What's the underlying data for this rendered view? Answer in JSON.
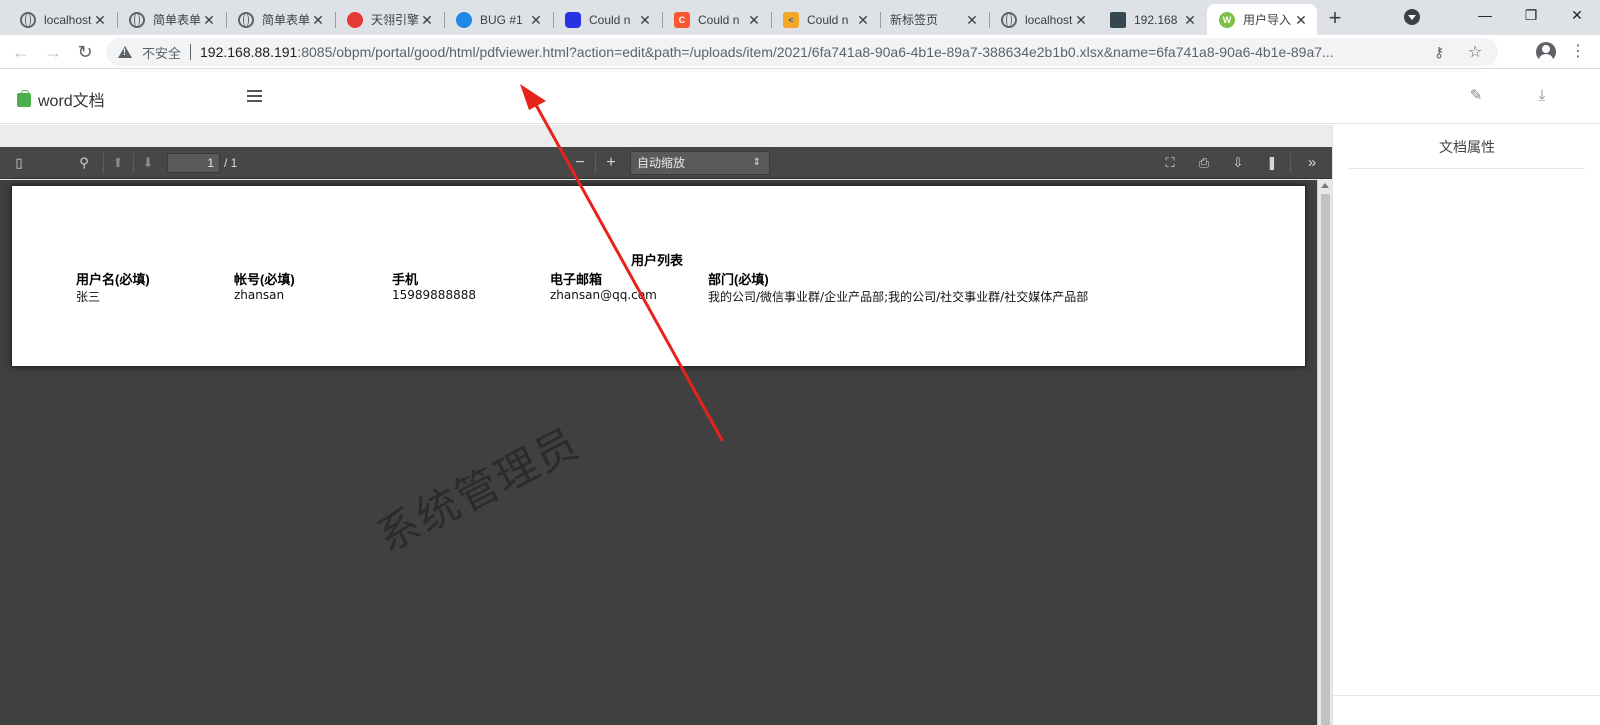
{
  "browser": {
    "tabs": [
      {
        "title": "localhost",
        "icon": "globe-icon",
        "active": false
      },
      {
        "title": "简单表单",
        "icon": "globe-icon",
        "active": false
      },
      {
        "title": "简单表单",
        "icon": "globe-icon",
        "active": false
      },
      {
        "title": "天翎引擎",
        "icon": "tianling-icon",
        "active": false
      },
      {
        "title": "BUG #1",
        "icon": "bug-tracker-icon",
        "active": false
      },
      {
        "title": "Could n",
        "icon": "baidu-paw-icon",
        "active": false
      },
      {
        "title": "Could n",
        "icon": "csdn-c-icon",
        "active": false
      },
      {
        "title": "Could n",
        "icon": "k-bracket-icon",
        "active": false
      },
      {
        "title": "新标签页",
        "icon": "",
        "active": false
      },
      {
        "title": "localhost",
        "icon": "globe-icon",
        "active": false
      },
      {
        "title": "192.168",
        "icon": "photo-icon",
        "active": false
      },
      {
        "title": "用户导入",
        "icon": "w-app-icon",
        "active": true
      }
    ],
    "new_tab_label": "+",
    "address": {
      "insecure_label": "不安全",
      "host": "192.168.88.191",
      "rest": ":8085/obpm/portal/good/html/pdfviewer.html?action=edit&path=/uploads/item/2021/6fa741a8-90a6-4b1e-89a7-388634e2b1b0.xlsx&name=6fa741a8-90a6-4b1e-89a7..."
    }
  },
  "app": {
    "title": "word文档",
    "accent": "#4cae4c"
  },
  "pdf_toolbar": {
    "page_value": "1",
    "page_count": "/ 1",
    "scale": "自动缩放"
  },
  "document": {
    "title": "用户列表",
    "headers": [
      "用户名(必填)",
      "帐号(必填)",
      "手机",
      "电子邮箱",
      "部门(必填)"
    ],
    "row": [
      "张三",
      "zhansan",
      "15989888888",
      "zhansan@qq.com",
      "我的公司/微信事业群/企业产品部;我的公司/社交事业群/社交媒体产品部"
    ]
  },
  "watermark": "系统管理员",
  "panel": {
    "title": "文档属性"
  },
  "colors": {
    "annotation_arrow": "#e8221c",
    "viewer_bg": "#404040",
    "toolbar_bg": "#474747"
  }
}
